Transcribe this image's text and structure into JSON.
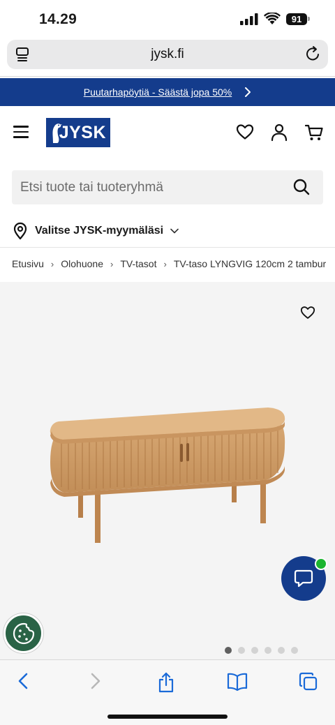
{
  "status": {
    "time": "14.29",
    "battery": "91"
  },
  "browser": {
    "url": "jysk.fi"
  },
  "promo": {
    "text": "Puutarhapöytiä - Säästä jopa 50%"
  },
  "header": {
    "logo_text": "JYSK"
  },
  "search": {
    "placeholder": "Etsi tuote tai tuoteryhmä"
  },
  "store": {
    "label": "Valitse JYSK-myymäläsi"
  },
  "breadcrumb": {
    "items": [
      "Etusivu",
      "Olohuone",
      "TV-tasot",
      "TV-taso LYNGVIG 120cm 2 tambur"
    ]
  },
  "carousel": {
    "slides": 6,
    "active_index": 0
  },
  "colors": {
    "brand_blue": "#143c8c",
    "chat_badge": "#1bb52f",
    "cookie_bg": "#2a6346"
  }
}
